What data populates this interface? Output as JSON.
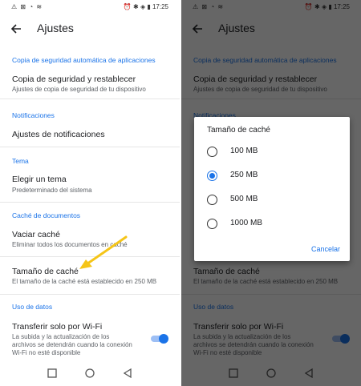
{
  "status_bar": {
    "time": "17:25",
    "left_icons": "⚠ ⊠ ◔ ≋",
    "right_icons": "⏰ ✱ ◈ ▮"
  },
  "app_bar": {
    "title": "Ajustes"
  },
  "settings": {
    "sections": [
      {
        "header": "Copia de seguridad automática de aplicaciones"
      },
      {
        "header": "Notificaciones"
      },
      {
        "header": "Tema"
      },
      {
        "header": "Caché de documentos"
      },
      {
        "header": "Uso de datos"
      }
    ],
    "items": [
      {
        "title": "Copia de seguridad y restablecer",
        "subtitle": "Ajustes de copia de seguridad de tu dispositivo"
      },
      {
        "title": "Ajustes de notificaciones"
      },
      {
        "title": "Elegir un tema",
        "subtitle": "Predeterminado del sistema"
      },
      {
        "title": "Vaciar caché",
        "subtitle": "Eliminar todos los documentos en caché"
      },
      {
        "title": "Tamaño de caché",
        "subtitle": "El tamaño de la caché está establecido en 250 MB"
      },
      {
        "title": "Transferir solo por Wi-Fi",
        "subtitle": "La subida y la actualización de los archivos se detendrán cuando la conexión Wi-Fi no esté disponible",
        "toggle_on": true
      }
    ]
  },
  "dialog": {
    "title": "Tamaño de caché",
    "options": [
      "100 MB",
      "250 MB",
      "500 MB",
      "1000 MB"
    ],
    "selected": "250 MB",
    "cancel_label": "Cancelar"
  },
  "colors": {
    "accent": "#1a73e8",
    "annotation_arrow": "#f5c518"
  }
}
